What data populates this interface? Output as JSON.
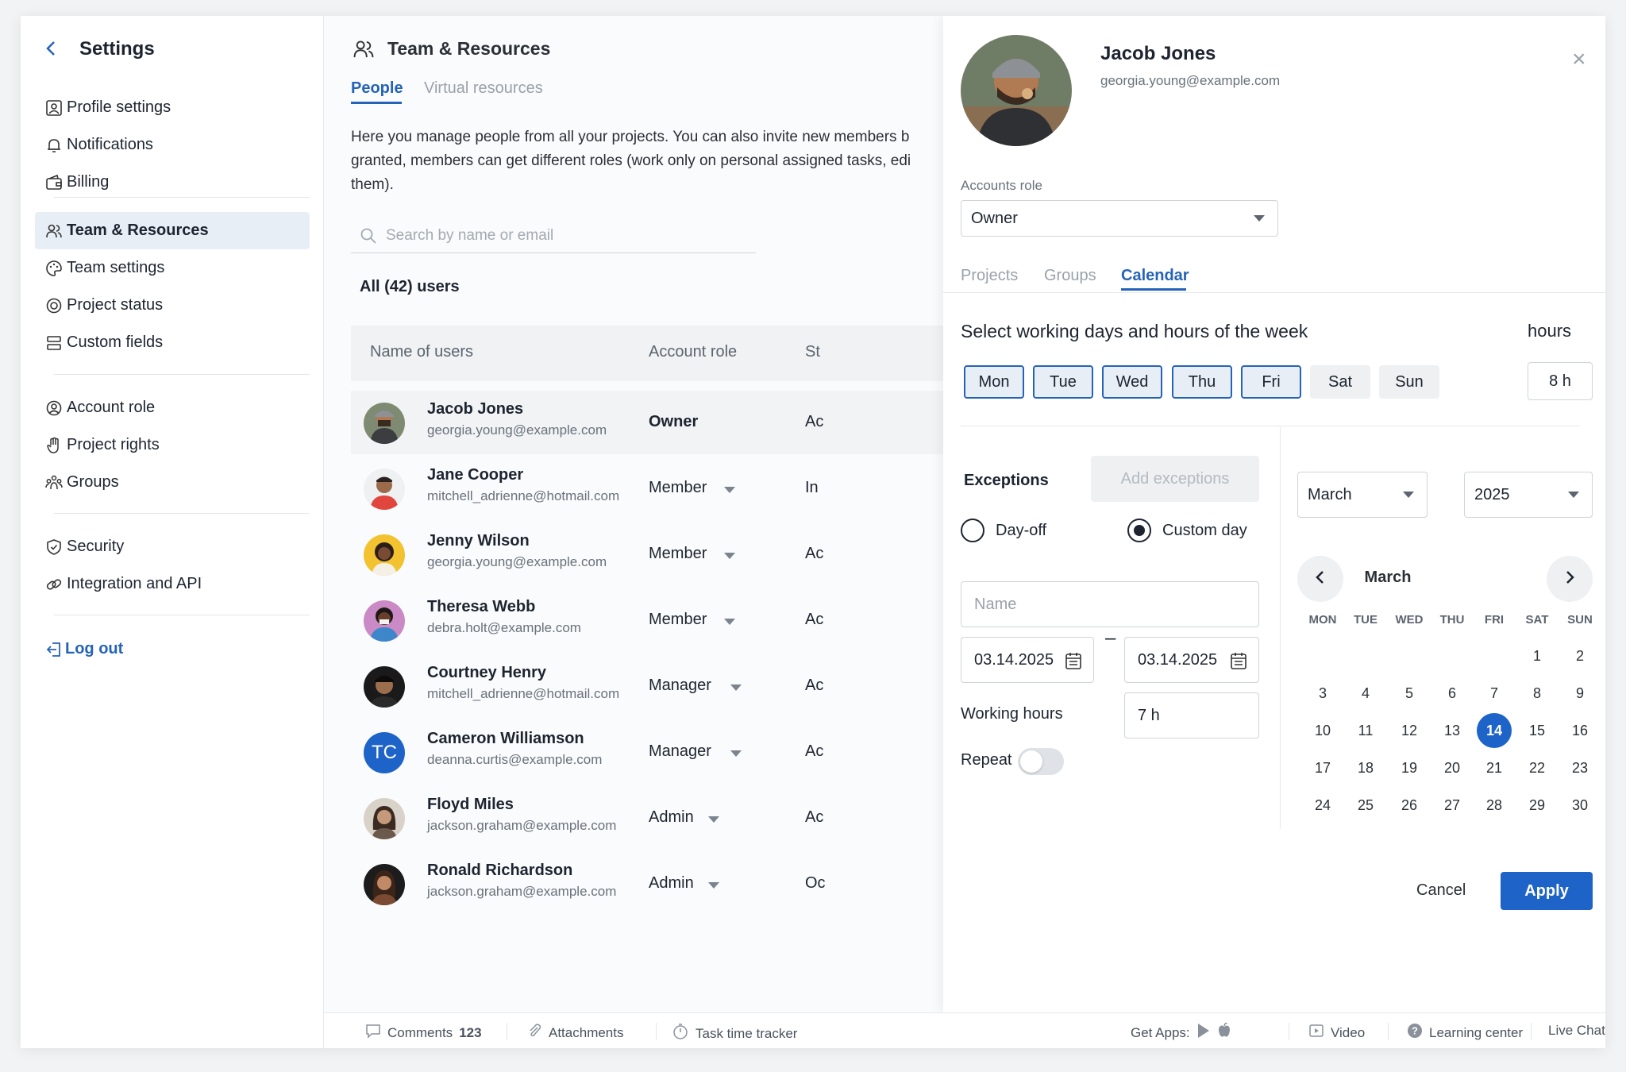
{
  "sidebar": {
    "title": "Settings",
    "items": [
      {
        "label": "Profile settings"
      },
      {
        "label": "Notifications"
      },
      {
        "label": "Billing"
      },
      {
        "label": "Team & Resources"
      },
      {
        "label": "Team settings"
      },
      {
        "label": "Project status"
      },
      {
        "label": "Custom fields"
      },
      {
        "label": "Account role"
      },
      {
        "label": "Project rights"
      },
      {
        "label": "Groups"
      },
      {
        "label": "Security"
      },
      {
        "label": "Integration and API"
      }
    ],
    "logout": "Log out"
  },
  "main": {
    "title": "Team & Resources",
    "tabs": [
      "People",
      "Virtual resources"
    ],
    "description": "Here you manage people from all your projects. You can also invite new members b\ngranted, members can get different roles (work only on personal assigned tasks, edi\nthem).",
    "search_placeholder": "Search by name or email",
    "count": "All (42) users",
    "columns": [
      "Name of users",
      "Account role",
      "St"
    ],
    "users": [
      {
        "name": "Jacob Jones",
        "email": "georgia.young@example.com",
        "role": "Owner",
        "status": "Ac"
      },
      {
        "name": "Jane Cooper",
        "email": "mitchell_adrienne@hotmail.com",
        "role": "Member",
        "status": "In"
      },
      {
        "name": "Jenny Wilson",
        "email": "georgia.young@example.com",
        "role": "Member",
        "status": "Ac"
      },
      {
        "name": "Theresa Webb",
        "email": "debra.holt@example.com",
        "role": "Member",
        "status": "Ac"
      },
      {
        "name": "Courtney Henry",
        "email": "mitchell_adrienne@hotmail.com",
        "role": "Manager",
        "status": "Ac"
      },
      {
        "name": "Cameron Williamson",
        "email": "deanna.curtis@example.com",
        "role": "Manager",
        "status": "Ac",
        "initials": "TC"
      },
      {
        "name": "Floyd Miles",
        "email": "jackson.graham@example.com",
        "role": "Admin",
        "status": "Ac"
      },
      {
        "name": "Ronald Richardson",
        "email": "jackson.graham@example.com",
        "role": "Admin",
        "status": "Oc"
      }
    ]
  },
  "panel": {
    "name": "Jacob Jones",
    "email": "georgia.young@example.com",
    "close": "×",
    "role_label": "Accounts role",
    "role_value": "Owner",
    "tabs": [
      "Projects",
      "Groups",
      "Calendar"
    ],
    "week_heading": "Select working days and hours of the week",
    "hours_label": "hours",
    "days": [
      "Mon",
      "Tue",
      "Wed",
      "Thu",
      "Fri",
      "Sat",
      "Sun"
    ],
    "hours_value": "8 h",
    "exceptions_label": "Exceptions",
    "add_exceptions": "Add exceptions",
    "radio_dayoff": "Day-off",
    "radio_custom": "Custom day",
    "name_placeholder": "Name",
    "date_from": "03.14.2025",
    "date_dash": "–",
    "date_to": "03.14.2025",
    "working_hours_label": "Working hours",
    "working_hours_value": "7 h",
    "repeat_label": "Repeat",
    "month_select": "March",
    "year_select": "2025",
    "calendar_title": "March",
    "weekdays": [
      "MON",
      "TUE",
      "WED",
      "THU",
      "FRI",
      "SAT",
      "SUN"
    ],
    "dates": [
      "1",
      "2",
      "3",
      "4",
      "5",
      "6",
      "7",
      "8",
      "9",
      "10",
      "11",
      "12",
      "13",
      "14",
      "15",
      "16",
      "17",
      "18",
      "19",
      "20",
      "21",
      "22",
      "23",
      "24",
      "25",
      "26",
      "27",
      "28",
      "29",
      "30"
    ],
    "selected_date": "14",
    "cancel": "Cancel",
    "apply": "Apply"
  },
  "footer": {
    "comments": "Comments",
    "comments_count": "123",
    "attachments": "Attachments",
    "tracker": "Task time tracker",
    "get_apps": "Get Apps:",
    "video": "Video",
    "learning": "Learning center",
    "chat": "Live Chat"
  },
  "colors": {
    "accent": "#1e64c8",
    "active_bg": "#e8eef6"
  }
}
